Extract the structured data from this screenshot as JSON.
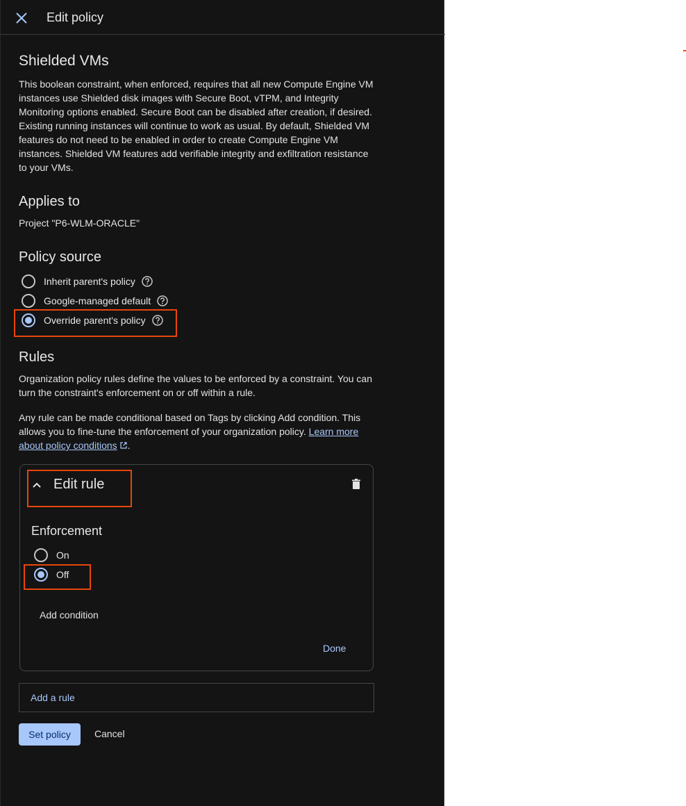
{
  "topbar": {
    "title": "Edit policy",
    "close_icon": "close-icon"
  },
  "constraint": {
    "title": "Shielded VMs",
    "description": "This boolean constraint, when enforced, requires that all new Compute Engine VM instances use Shielded disk images with Secure Boot, vTPM, and Integrity Monitoring options enabled. Secure Boot can be disabled after creation, if desired. Existing running instances will continue to work as usual. By default, Shielded VM features do not need to be enabled in order to create Compute Engine VM instances. Shielded VM features add verifiable integrity and exfiltration resistance to your VMs."
  },
  "applies_to": {
    "heading": "Applies to",
    "value": "Project \"P6-WLM-ORACLE\""
  },
  "policy_source": {
    "heading": "Policy source",
    "options": [
      {
        "label": "Inherit parent's policy",
        "selected": false
      },
      {
        "label": "Google-managed default",
        "selected": false
      },
      {
        "label": "Override parent's policy",
        "selected": true
      }
    ]
  },
  "rules": {
    "heading": "Rules",
    "description": "Organization policy rules define the values to be enforced by a constraint. You can turn the constraint's enforcement on or off within a rule.",
    "conditional_text": "Any rule can be made conditional based on Tags by clicking Add condition. This allows you to fine-tune the enforcement of your organization policy.",
    "learn_more_link": "Learn more about policy conditions",
    "period": "."
  },
  "edit_rule": {
    "title": "Edit rule",
    "enforcement_heading": "Enforcement",
    "options": [
      {
        "label": "On",
        "selected": false
      },
      {
        "label": "Off",
        "selected": true
      }
    ],
    "add_condition": "Add condition",
    "done": "Done"
  },
  "add_rule": "Add a rule",
  "actions": {
    "set_policy": "Set policy",
    "cancel": "Cancel"
  },
  "colors": {
    "panel_bg": "#141414",
    "accent": "#a8c7fa",
    "highlight": "#e8470a"
  }
}
